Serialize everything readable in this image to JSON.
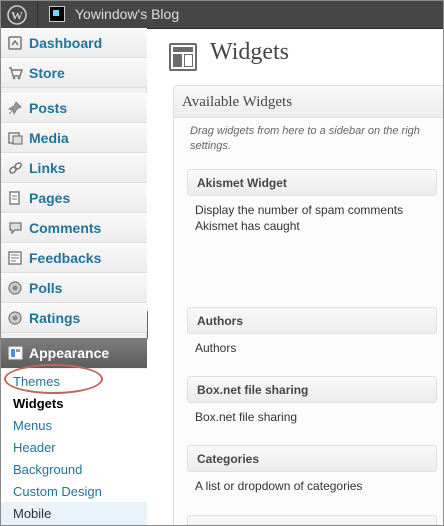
{
  "admin_bar": {
    "site_name": "Yowindow's Blog"
  },
  "sidebar": {
    "items": [
      {
        "label": "Dashboard",
        "icon": "dashboard-icon"
      },
      {
        "label": "Store",
        "icon": "cart-icon"
      },
      {
        "label": "Posts",
        "icon": "pin-icon"
      },
      {
        "label": "Media",
        "icon": "media-icon"
      },
      {
        "label": "Links",
        "icon": "link-icon"
      },
      {
        "label": "Pages",
        "icon": "pages-icon"
      },
      {
        "label": "Comments",
        "icon": "comments-icon"
      },
      {
        "label": "Feedbacks",
        "icon": "feedback-icon"
      },
      {
        "label": "Polls",
        "icon": "polls-icon"
      },
      {
        "label": "Ratings",
        "icon": "ratings-icon"
      }
    ],
    "active": {
      "label": "Appearance",
      "icon": "appearance-icon"
    },
    "submenu": [
      "Themes",
      "Widgets",
      "Menus",
      "Header",
      "Background",
      "Custom Design",
      "Mobile"
    ]
  },
  "main": {
    "title": "Widgets",
    "panel": {
      "title": "Available Widgets",
      "description": "Drag widgets from here to a sidebar on the righ settings."
    },
    "widgets": [
      {
        "title": "Akismet Widget",
        "description": "Display the number of spam comments Akismet has caught"
      },
      {
        "title": "Authors",
        "description": "Authors"
      },
      {
        "title": "Box.net file sharing",
        "description": "Box.net file sharing"
      },
      {
        "title": "Categories",
        "description": "A list or dropdown of categories"
      }
    ]
  },
  "colors": {
    "link": "#21759b",
    "admin_bar": "#464646",
    "highlight_circle": "#c0665b"
  }
}
